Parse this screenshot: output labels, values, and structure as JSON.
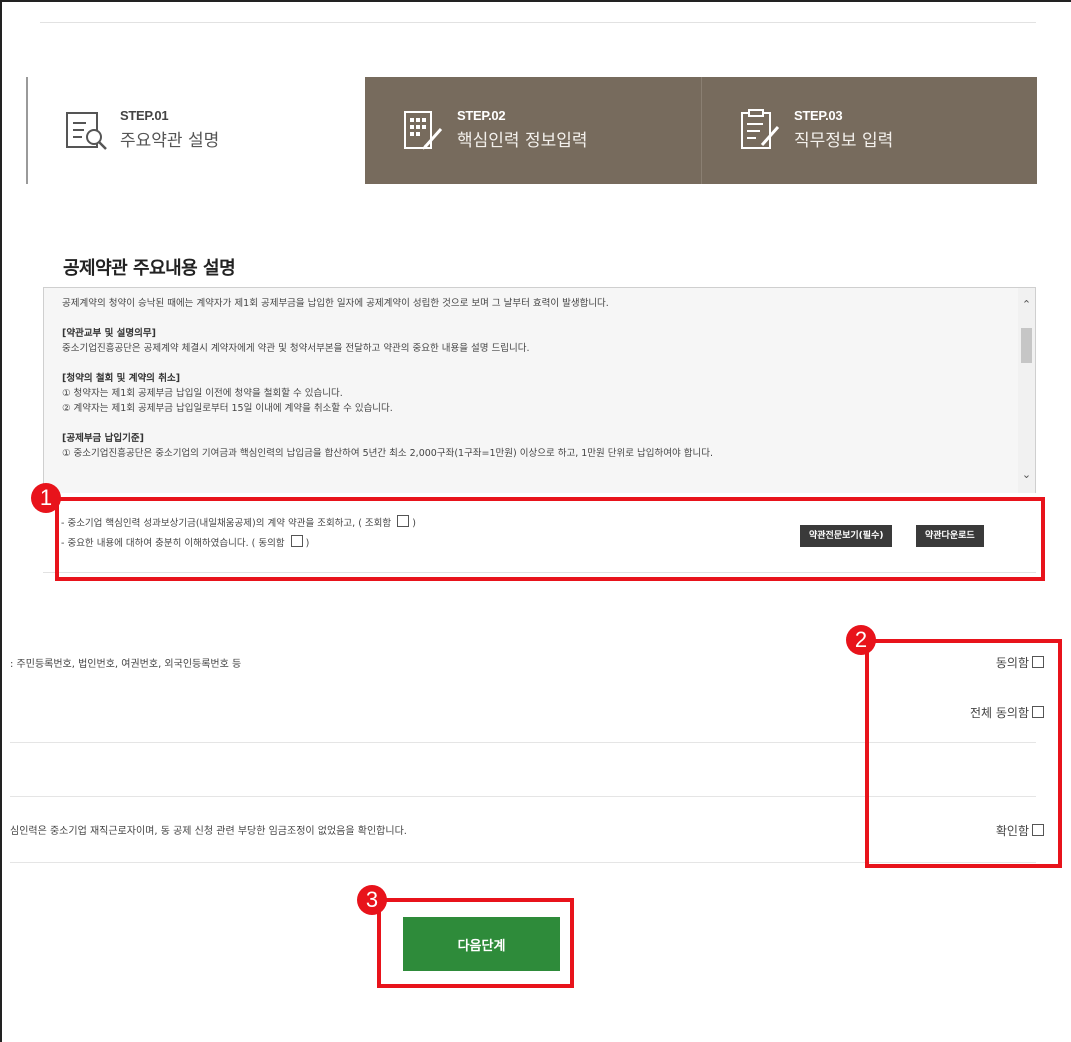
{
  "steps": [
    {
      "num": "STEP.01",
      "label": "주요약관 설명"
    },
    {
      "num": "STEP.02",
      "label": "핵심인력 정보입력"
    },
    {
      "num": "STEP.03",
      "label": "직무정보 입력"
    }
  ],
  "section_title": "공제약관 주요내용 설명",
  "terms": {
    "intro": "공제계약의 청약이 승낙된 때에는 계약자가 제1회 공제부금을 납입한 일자에 공제계약이 성립한 것으로 보며 그 날부터 효력이 발생합니다.",
    "s1_title": "[약관교부 및 설명의무]",
    "s1_line1": "중소기업진흥공단은 공제계약 체결시 계약자에게 약관 및 청약서부본을 전달하고 약관의 중요한 내용을 설명 드립니다.",
    "s2_title": "[청약의 철회 및 계약의 취소]",
    "s2_line1": "① 청약자는 제1회 공제부금 납입일 이전에 청약을 철회할 수 있습니다.",
    "s2_line2": "② 계약자는 제1회 공제부금 납입일로부터 15일 이내에 계약을 취소할 수 있습니다.",
    "s3_title": "[공제부금 납입기준]",
    "s3_line1": "① 중소기업진흥공단은 중소기업의 기여금과 핵심인력의 납입금을 합산하여 5년간 최소 2,000구좌(1구좌=1만원) 이상으로 하고, 1만원 단위로 납입하여야 합니다."
  },
  "agree": {
    "line1": "- 중소기업 핵심인력 성과보상기금(내일채움공제)의 계약 약관을 조회하고, ( 조회함",
    "line1_end": ")",
    "line2": "- 중요한 내용에 대하여 충분히 이해하였습니다. ( 동의함",
    "line2_end": ")",
    "btn_full": "약관전문보기(필수)",
    "btn_download": "약관다운로드"
  },
  "consent": {
    "id_text": ": 주민등록번호, 법인번호, 여권번호, 외국인등록번호 등",
    "agree_label": "동의함",
    "all_agree_label": "전체 동의함",
    "confirm_text": "심인력은 중소기업 재직근로자이며, 동 공제 신청 관련 부당한 임금조정이 없었음을 확인합니다.",
    "confirm_label": "확인함"
  },
  "next_button": "다음단계",
  "annotations": [
    "1",
    "2",
    "3"
  ],
  "colors": {
    "step_active_bg": "#ffffff",
    "step_bg": "#776b5d",
    "next_btn": "#2e8b3a",
    "annotation": "#e8131b",
    "dark_btn": "#3a3a3a"
  }
}
